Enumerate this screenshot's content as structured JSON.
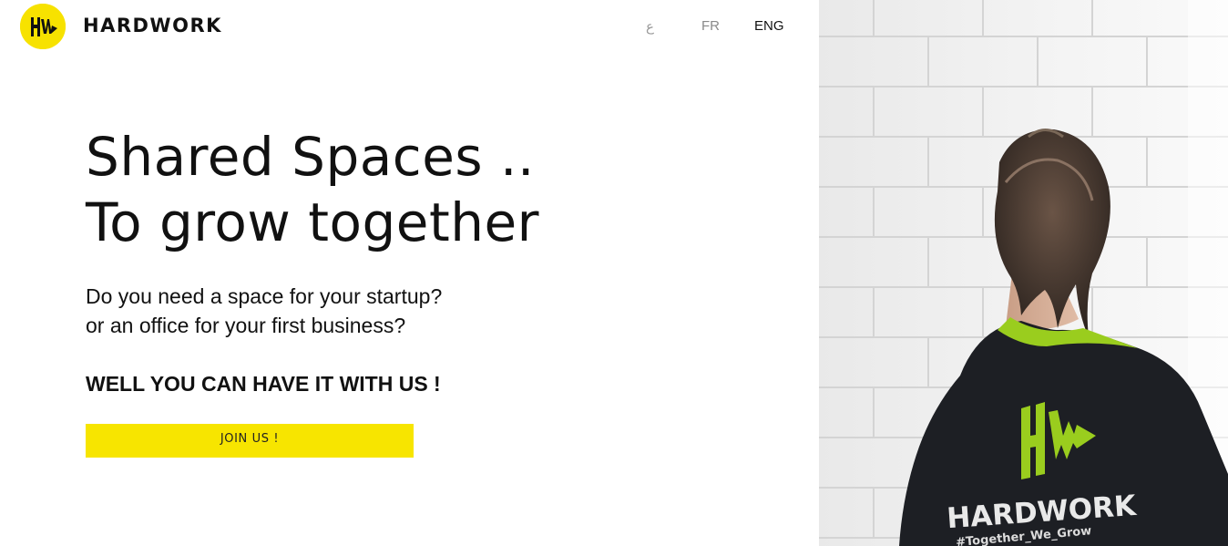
{
  "header": {
    "brand_name": "HARDWORK",
    "logo_text": "HW",
    "languages": {
      "arabic": "ع",
      "french": "FR",
      "english": "ENG"
    },
    "active_language": "ENG"
  },
  "hero": {
    "headline_line1": "Shared Spaces ..",
    "headline_line2": "To grow together",
    "subtext_line1": "Do you need a space for your startup?",
    "subtext_line2": "or an office for your first business?",
    "cta_heading": "WELL YOU CAN HAVE IT WITH US !",
    "join_button": "JOIN US !"
  },
  "photo": {
    "shirt_brand": "HARDWORK",
    "shirt_logo": "HW",
    "shirt_hashtag": "#Together_We_Grow"
  },
  "colors": {
    "accent_yellow": "#f7e500",
    "shirt_green": "#9acd1e",
    "shirt_dark": "#1d1f24",
    "text_dark": "#111111",
    "text_muted": "#8a8a8a"
  }
}
